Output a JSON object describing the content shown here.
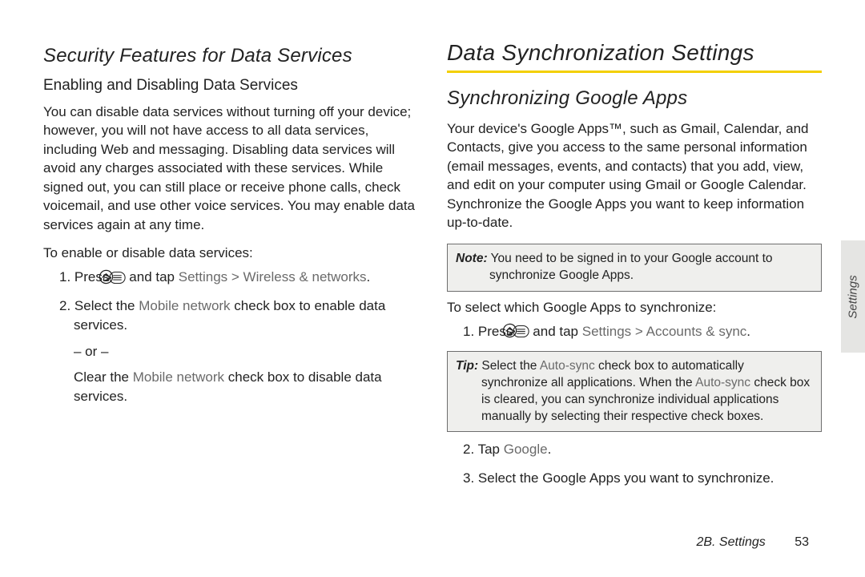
{
  "left": {
    "section_title": "Security Features for Data Services",
    "subhead": "Enabling and Disabling Data Services",
    "body": "You can disable data services without turning off your device; however, you will not have access to all data services, including Web and messaging. Disabling data services will avoid any charges associated with these services. While signed out, you can still place or receive phone calls, check voicemail, and use other voice services. You may enable data services again at any time.",
    "lead": "To enable or disable data services:",
    "step1_a": "1.  Press ",
    "step1_b": " and tap ",
    "step1_path": "Settings > Wireless & networks",
    "step1_end": ".",
    "step2_a": "2. Select the ",
    "step2_path": "Mobile network",
    "step2_b": "  check box to enable data services.",
    "or": "– or –",
    "step2c_a": "Clear the ",
    "step2c_path": "Mobile network",
    "step2c_b": "  check box to disable data services."
  },
  "right": {
    "main_title": "Data Synchronization Settings",
    "section_title": "Synchronizing Google Apps",
    "body": "Your device's Google Apps™, such as Gmail, Calendar, and Contacts, give you access to the same personal information (email messages, events, and contacts) that you add, view, and edit on your computer using Gmail or Google Calendar. Synchronize the Google Apps you want to keep information up-to-date.",
    "note_label": "Note:",
    "note_text": "  You need to be signed in to your Google account to synchronize Google Apps.",
    "lead": "To select which Google Apps to synchronize:",
    "step1_a": "1.  Press ",
    "step1_b": " and tap ",
    "step1_path": "Settings > Accounts & sync",
    "step1_end": ".",
    "tip_label": "Tip:",
    "tip_a": "  Select the ",
    "tip_path1": "Auto-sync",
    "tip_b": " check box to automatically synchronize all applications. When the ",
    "tip_path2": "Auto-sync",
    "tip_c": " check box is cleared, you can synchronize individual applications manually by selecting their respective check boxes.",
    "step2_a": "2. Tap ",
    "step2_path": "Google",
    "step2_end": ".",
    "step3": "3. Select the Google Apps you want to synchronize."
  },
  "sidetab": "Settings",
  "footer_chapter": "2B. Settings",
  "footer_page": "53"
}
